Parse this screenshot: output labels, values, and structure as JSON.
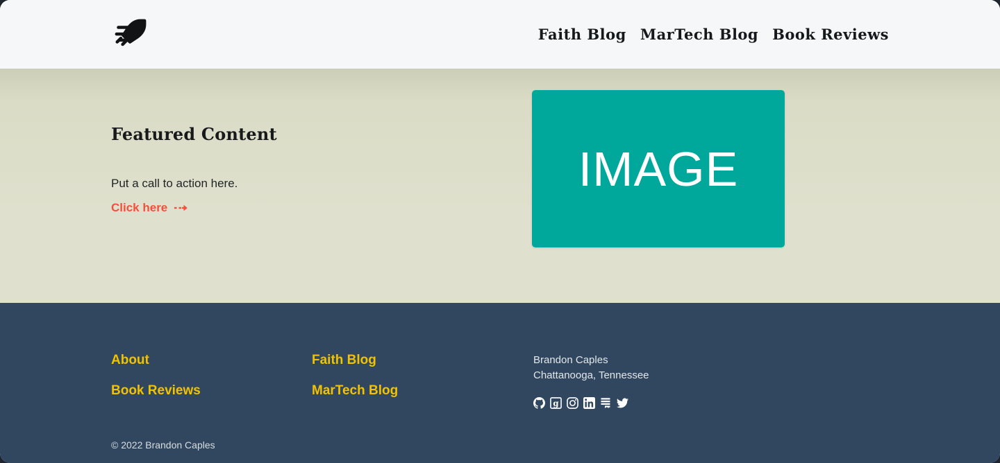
{
  "header": {
    "logo_alt": "rocket-logo",
    "nav": [
      {
        "label": "Faith Blog"
      },
      {
        "label": "MarTech Blog"
      },
      {
        "label": "Book Reviews"
      }
    ]
  },
  "hero": {
    "title": "Featured Content",
    "body": "Put a call to action here.",
    "cta_label": "Click here",
    "cta_arrow": "dashed-arrow-right-icon",
    "media_label": "IMAGE",
    "media_color": "#00a79b",
    "background_color": "#dfe0cd",
    "cta_color": "#f4503c"
  },
  "footer": {
    "background_color": "#31475f",
    "link_color": "#f2c200",
    "columns": [
      {
        "links": [
          {
            "label": "About"
          },
          {
            "label": "Book Reviews"
          }
        ]
      },
      {
        "links": [
          {
            "label": "Faith Blog"
          },
          {
            "label": "MarTech Blog"
          }
        ]
      }
    ],
    "address": {
      "name": "Brandon Caples",
      "location": "Chattanooga, Tennessee"
    },
    "socials": [
      {
        "name": "github-icon",
        "label": "GitHub"
      },
      {
        "name": "goodreads-icon",
        "label": "Goodreads"
      },
      {
        "name": "instagram-icon",
        "label": "Instagram"
      },
      {
        "name": "linkedin-icon",
        "label": "LinkedIn"
      },
      {
        "name": "substack-icon",
        "label": "Substack"
      },
      {
        "name": "twitter-icon",
        "label": "Twitter"
      }
    ],
    "copyright": "© 2022 Brandon Caples"
  }
}
